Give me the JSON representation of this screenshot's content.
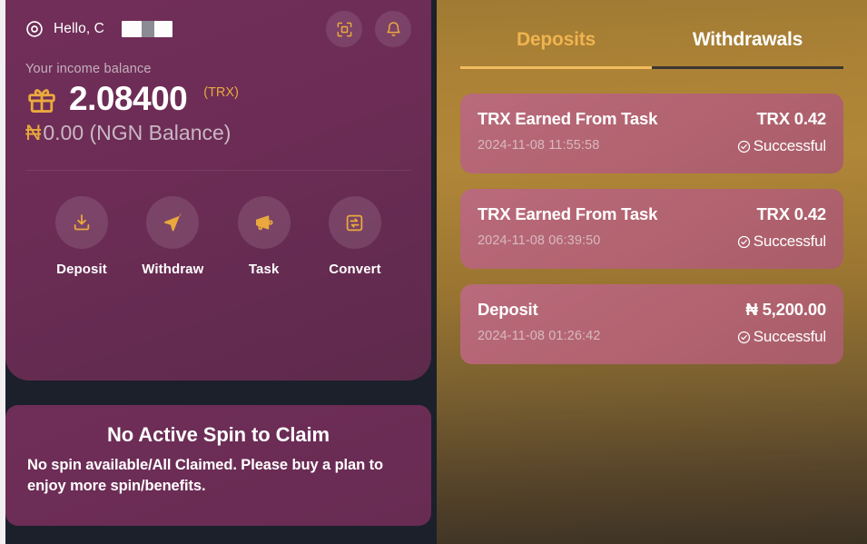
{
  "wallet": {
    "greeting": "Hello, C",
    "avatar_icon": "user-circle-icon",
    "scan_icon": "scan-frame-icon",
    "bell_icon": "bell-icon",
    "balance_label": "Your income balance",
    "balance_icon": "gift-icon",
    "balance_amount": "2.08400",
    "balance_currency": "(TRX)",
    "naira_symbol": "₦",
    "ngn_balance": "0.00 (NGN Balance)",
    "actions": [
      {
        "label": "Deposit",
        "icon": "download-icon"
      },
      {
        "label": "Withdraw",
        "icon": "send-icon"
      },
      {
        "label": "Task",
        "icon": "megaphone-icon"
      },
      {
        "label": "Convert",
        "icon": "exchange-icon"
      }
    ]
  },
  "spin": {
    "title": "No Active Spin to Claim",
    "subtitle": "No spin available/All Claimed. Please buy a plan to enjoy more spin/benefits."
  },
  "transactions_panel": {
    "tabs": [
      {
        "label": "Deposits",
        "active": true
      },
      {
        "label": "Withdrawals",
        "active": false
      }
    ],
    "items": [
      {
        "title": "TRX Earned From Task",
        "date": "2024-11-08 11:55:58",
        "amount": "TRX 0.42",
        "status": "Successful",
        "status_icon": "check-circle-icon"
      },
      {
        "title": "TRX Earned From Task",
        "date": "2024-11-08 06:39:50",
        "amount": "TRX 0.42",
        "status": "Successful",
        "status_icon": "check-circle-icon"
      },
      {
        "title": "Deposit",
        "date": "2024-11-08 01:26:42",
        "amount": "₦ 5,200.00",
        "status": "Successful",
        "status_icon": "check-circle-icon"
      }
    ]
  },
  "colors": {
    "card_purple": "#6e2d57",
    "accent_gold": "#e8a93c",
    "tab_active": "#f0b44f",
    "tx_card": "#b8687a",
    "page_dark": "#1b202b"
  }
}
